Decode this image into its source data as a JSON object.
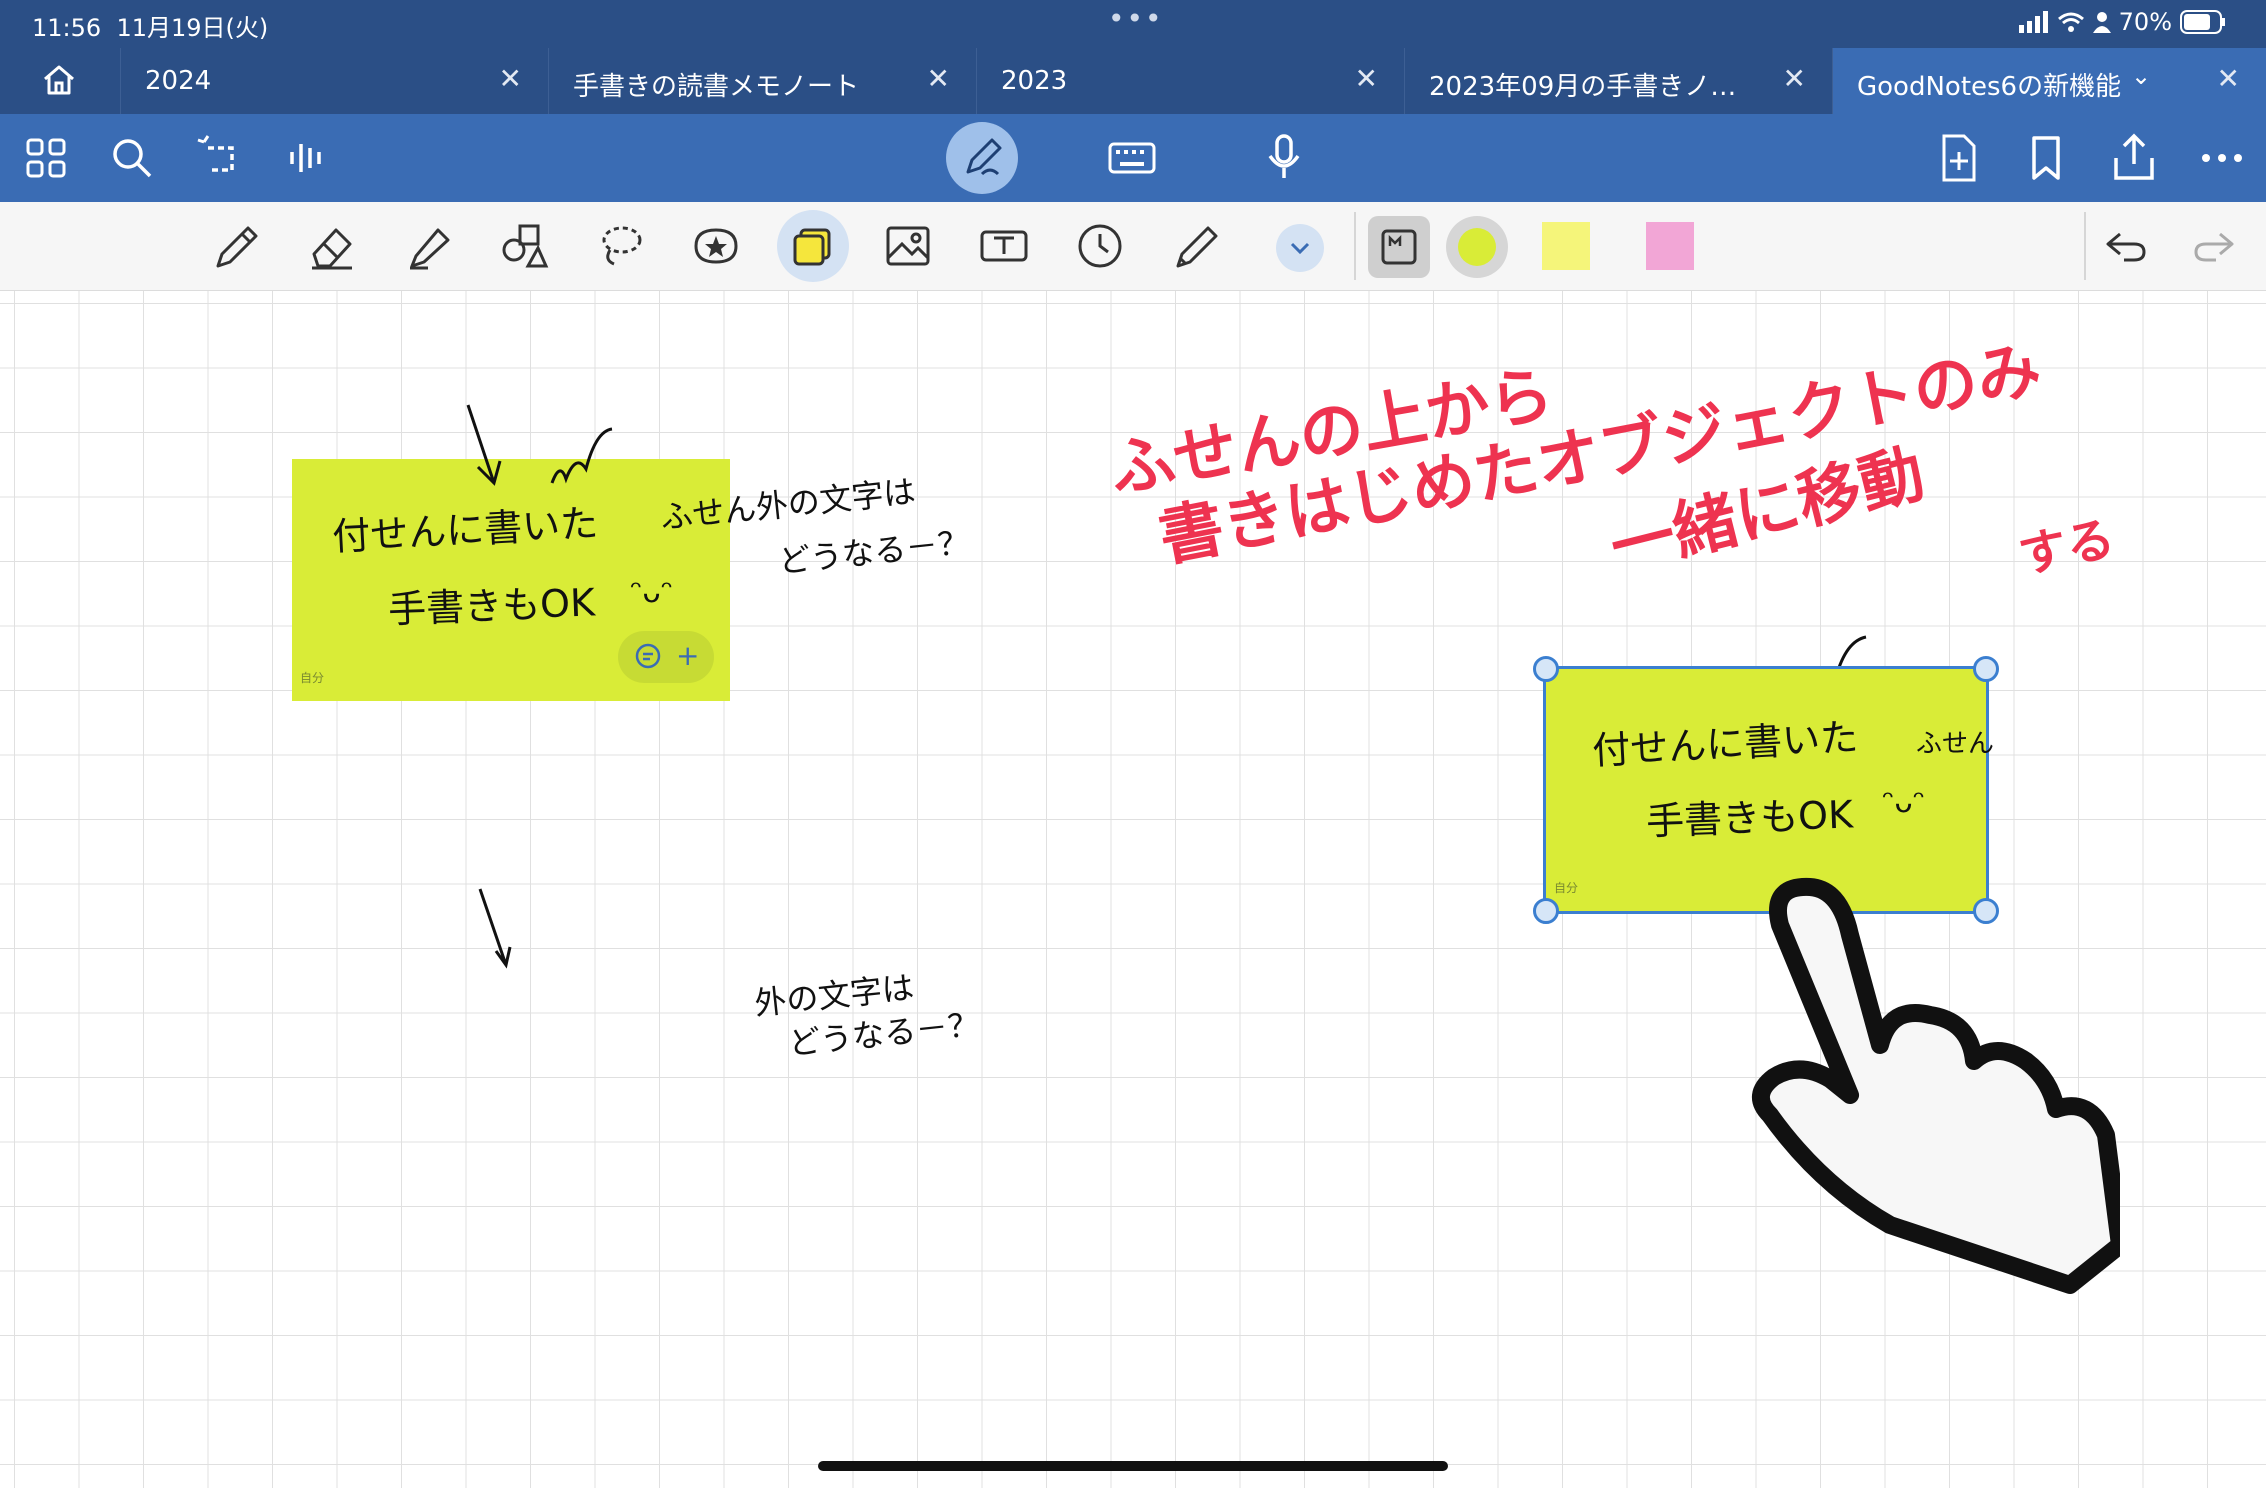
{
  "status": {
    "time": "11:56",
    "date": "11月19日(火)",
    "battery": "70%"
  },
  "tabs": [
    {
      "label": "2024"
    },
    {
      "label": "手書きの読書メモノート"
    },
    {
      "label": "2023"
    },
    {
      "label": "2023年09月の手書きノ…"
    },
    {
      "label": "GoodNotes6の新機能"
    }
  ],
  "toolbar": {
    "left_icons": [
      "grid-icon",
      "search-icon",
      "lasso-ai-icon",
      "audio-icon"
    ],
    "center_icons": [
      "pen-mode-icon",
      "keyboard-icon",
      "microphone-icon"
    ],
    "right_icons": [
      "add-page-icon",
      "bookmark-icon",
      "share-icon",
      "more-icon"
    ]
  },
  "pen_toolbar": {
    "tools": [
      "pen-icon",
      "eraser-icon",
      "highlighter-icon",
      "shapes-icon",
      "lasso-icon",
      "sticker-icon",
      "sticky-note-icon",
      "image-icon",
      "textbox-icon",
      "timer-icon",
      "pencil-icon",
      "expand-icon"
    ],
    "colors": {
      "note_yellow": "#f5f57a",
      "note_pink": "#f2a6d6",
      "selected_circle": "#d9ec37"
    }
  },
  "canvas": {
    "note_left": {
      "line1": "付せんに書いた",
      "line2": "手書きもOK",
      "smiley": "ᵔᴗᵔ",
      "owner": "自分",
      "comment_plus": "+"
    },
    "note_right": {
      "line1": "付せんに書いた",
      "line2": "手書きもOK",
      "smiley": "ᵔᴗᵔ",
      "owner": "自分",
      "overflow": "ふせん"
    },
    "left_annotation": {
      "line1": "ふせん外の文字は",
      "line2": "どうなる－？"
    },
    "lower_annotation": {
      "line1": "外の文字は",
      "line2": "どうなる－？"
    },
    "red_text": {
      "line1": "ふせんの上から",
      "line2": "書きはじめたオブジェクトのみ",
      "line3": "一緒に移動",
      "line4": "する"
    }
  }
}
